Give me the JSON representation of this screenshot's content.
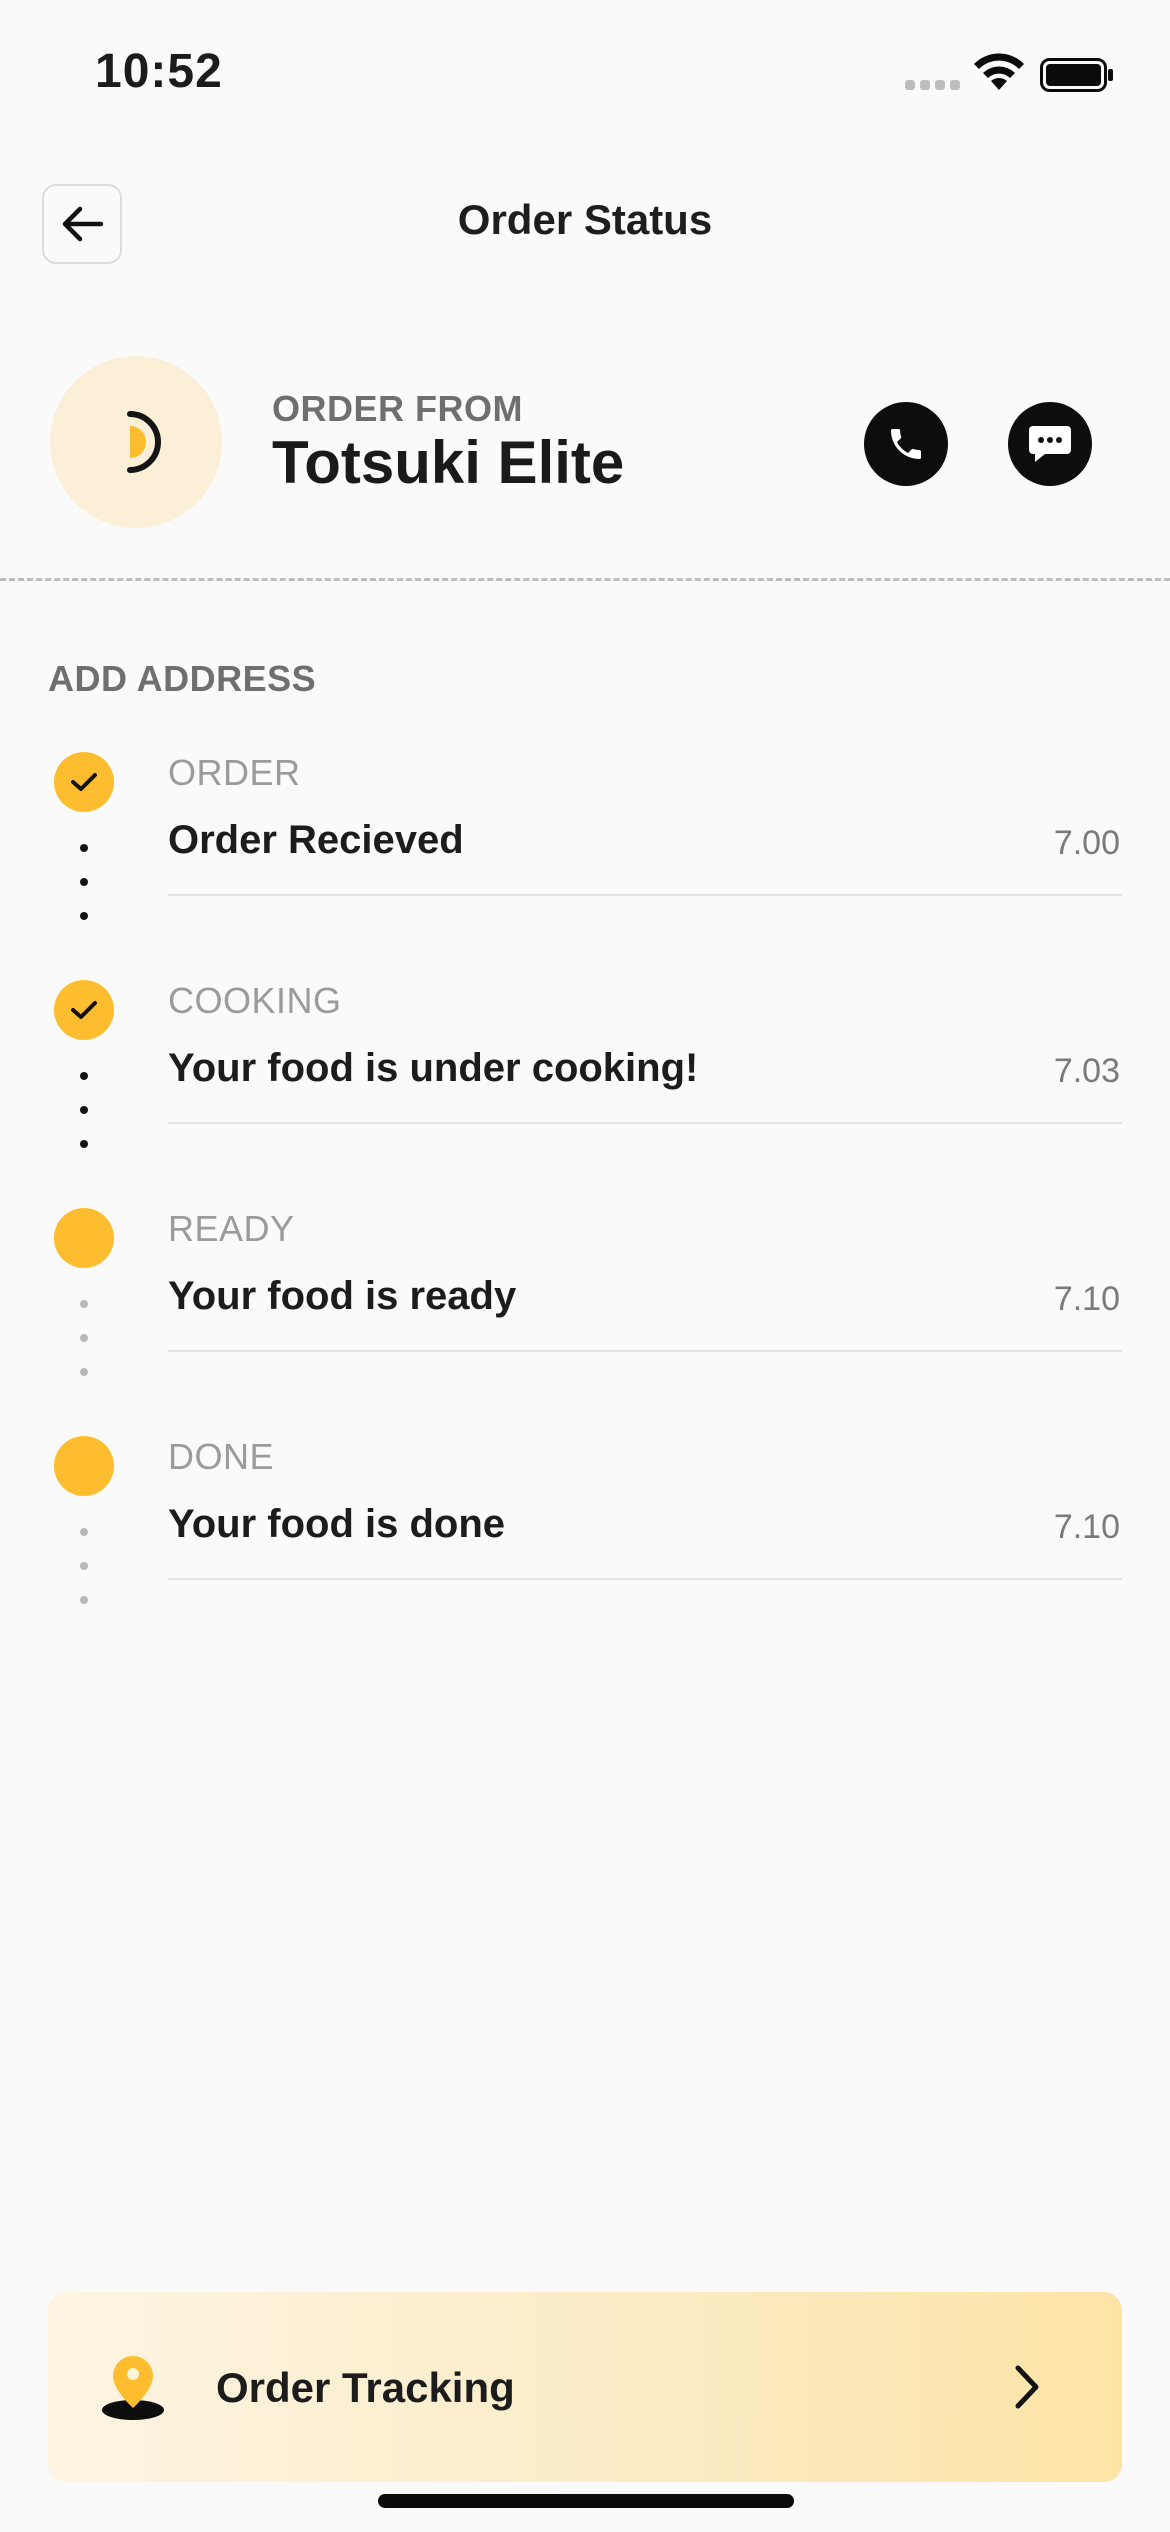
{
  "status_bar": {
    "time": "10:52"
  },
  "header": {
    "title": "Order Status"
  },
  "restaurant": {
    "order_from_label": "ORDER FROM",
    "name": "Totsuki Elite"
  },
  "address": {
    "label": "ADD ADDRESS"
  },
  "steps": [
    {
      "category": "ORDER",
      "title": "Order Recieved",
      "time": "7.00",
      "checked": true
    },
    {
      "category": "COOKING",
      "title": "Your food is under cooking!",
      "time": "7.03",
      "checked": true
    },
    {
      "category": "READY",
      "title": "Your food is ready",
      "time": "7.10",
      "checked": false
    },
    {
      "category": "DONE",
      "title": "Your food is done",
      "time": "7.10",
      "checked": false
    }
  ],
  "tracking": {
    "label": "Order Tracking"
  },
  "colors": {
    "accent": "#fdbd2e",
    "dark": "#0d0d0d",
    "logo_bg": "#fbefd8"
  },
  "icons": {
    "back": "arrow-left-icon",
    "call": "phone-icon",
    "chat": "chat-bubble-icon",
    "check": "check-icon",
    "location": "location-pin-icon",
    "chevron": "chevron-right-icon"
  }
}
